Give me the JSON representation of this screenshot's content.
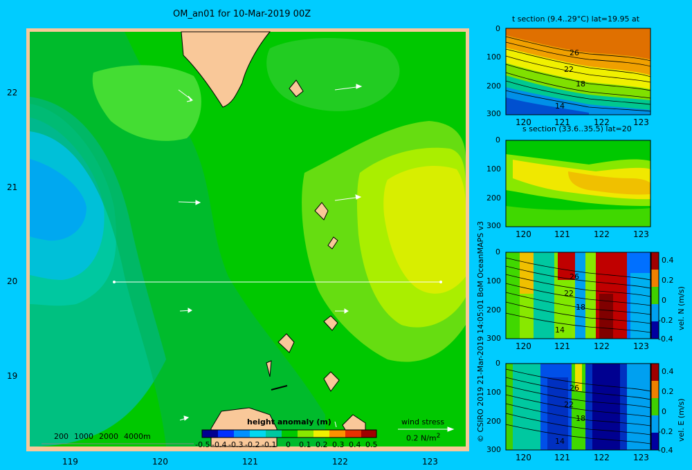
{
  "map": {
    "title": "OM_an01 for 10-Mar-2019 00Z",
    "lat_ticks": [
      "22",
      "21",
      "20",
      "19"
    ],
    "lon_ticks": [
      "119",
      "120",
      "121",
      "122",
      "123"
    ],
    "depth_legend": [
      "200",
      "1000",
      "2000",
      "4000m"
    ],
    "colorbar_title": "height anomaly (m)",
    "colorbar_ticks": [
      "-0.5",
      "-0.4",
      "-0.3",
      "-0.2",
      "-0.1",
      "0",
      "0.1",
      "0.2",
      "0.3",
      "0.4",
      "0.5"
    ],
    "wind_label": "wind stress",
    "wind_scale": "0.2 N/m",
    "wind_scale_sup": "2"
  },
  "side_text": {
    "credit": "© CSIRO 2019   21-Mar-2019 14:05:01 BoM OceanMAPS v3"
  },
  "panels": [
    {
      "title": "t section (9.4..29°C) lat=19.95 at",
      "depth_ticks": [
        "0",
        "100",
        "200",
        "300"
      ],
      "lon_ticks": [
        "120",
        "121",
        "122",
        "123"
      ],
      "contour_labels": [
        "26",
        "22",
        "18",
        "14"
      ]
    },
    {
      "title": "s section (33.6..35.5) lat=20",
      "depth_ticks": [
        "0",
        "100",
        "200",
        "300"
      ],
      "lon_ticks": [
        "120",
        "121",
        "122",
        "123"
      ],
      "contour_labels": []
    },
    {
      "title": "",
      "depth_ticks": [
        "0",
        "100",
        "200",
        "300"
      ],
      "lon_ticks": [
        "120",
        "121",
        "122",
        "123"
      ],
      "contour_labels": [
        "26",
        "22",
        "18",
        "14"
      ],
      "colorbar_label": "vel. N (m/s)",
      "colorbar_ticks": [
        "0.4",
        "0.2",
        "0",
        "-0.2",
        "-0.4"
      ]
    },
    {
      "title": "",
      "depth_ticks": [
        "0",
        "100",
        "200",
        "300"
      ],
      "lon_ticks": [
        "120",
        "121",
        "122",
        "123"
      ],
      "contour_labels": [
        "26",
        "22",
        "18",
        "14"
      ],
      "colorbar_label": "vel. E (m/s)",
      "colorbar_ticks": [
        "0.4",
        "0.2",
        "0",
        "-0.2",
        "-0.4"
      ]
    }
  ],
  "colors": {
    "background": "#00ccff",
    "land": "#f9c899",
    "map_frame": "#f9c899"
  }
}
